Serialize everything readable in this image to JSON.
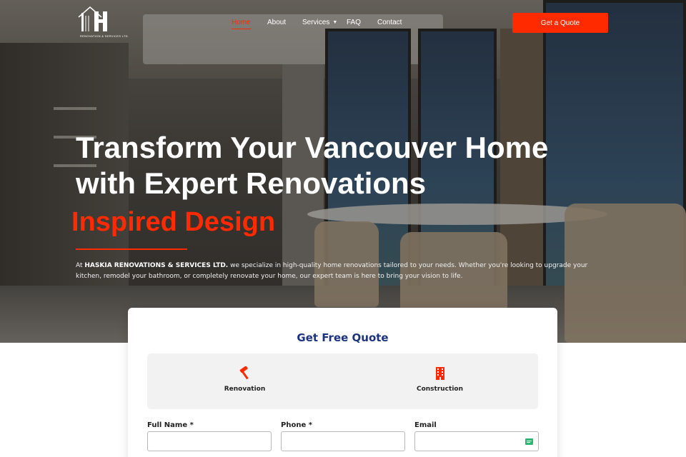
{
  "brand": {
    "logo_letter": "H",
    "logo_subtext": "RENOVATION & SERVICES LTD."
  },
  "nav": {
    "items": [
      {
        "label": "Home",
        "active": true
      },
      {
        "label": "About"
      },
      {
        "label": "Services",
        "has_dropdown": true
      },
      {
        "label": "FAQ"
      },
      {
        "label": "Contact"
      }
    ],
    "cta_label": "Get a Quote"
  },
  "hero": {
    "title_line1": "Transform Your Vancouver Home",
    "title_line2": "with Expert Renovations",
    "subtitle": "Inspired Design",
    "desc_prefix": "At ",
    "desc_company": "HASKIA RENOVATIONS & SERVICES LTD.",
    "desc_rest": " we specialize in high-quality home renovations tailored to your needs. Whether you're looking to upgrade your kitchen, remodel your bathroom, or completely renovate your home, our expert team is here to bring your vision to life."
  },
  "quote_form": {
    "title": "Get Free Quote",
    "options": [
      {
        "label": "Renovation",
        "icon": "hammer-icon"
      },
      {
        "label": "Construction",
        "icon": "building-icon"
      }
    ],
    "fields": [
      {
        "label": "Full Name *",
        "value": "",
        "placeholder": ""
      },
      {
        "label": "Phone *",
        "value": "",
        "placeholder": ""
      },
      {
        "label": "Email",
        "value": "",
        "placeholder": ""
      }
    ]
  },
  "colors": {
    "accent": "#ff2a00",
    "heading_blue": "#1c3380",
    "option_bg": "#f2f2f2"
  }
}
